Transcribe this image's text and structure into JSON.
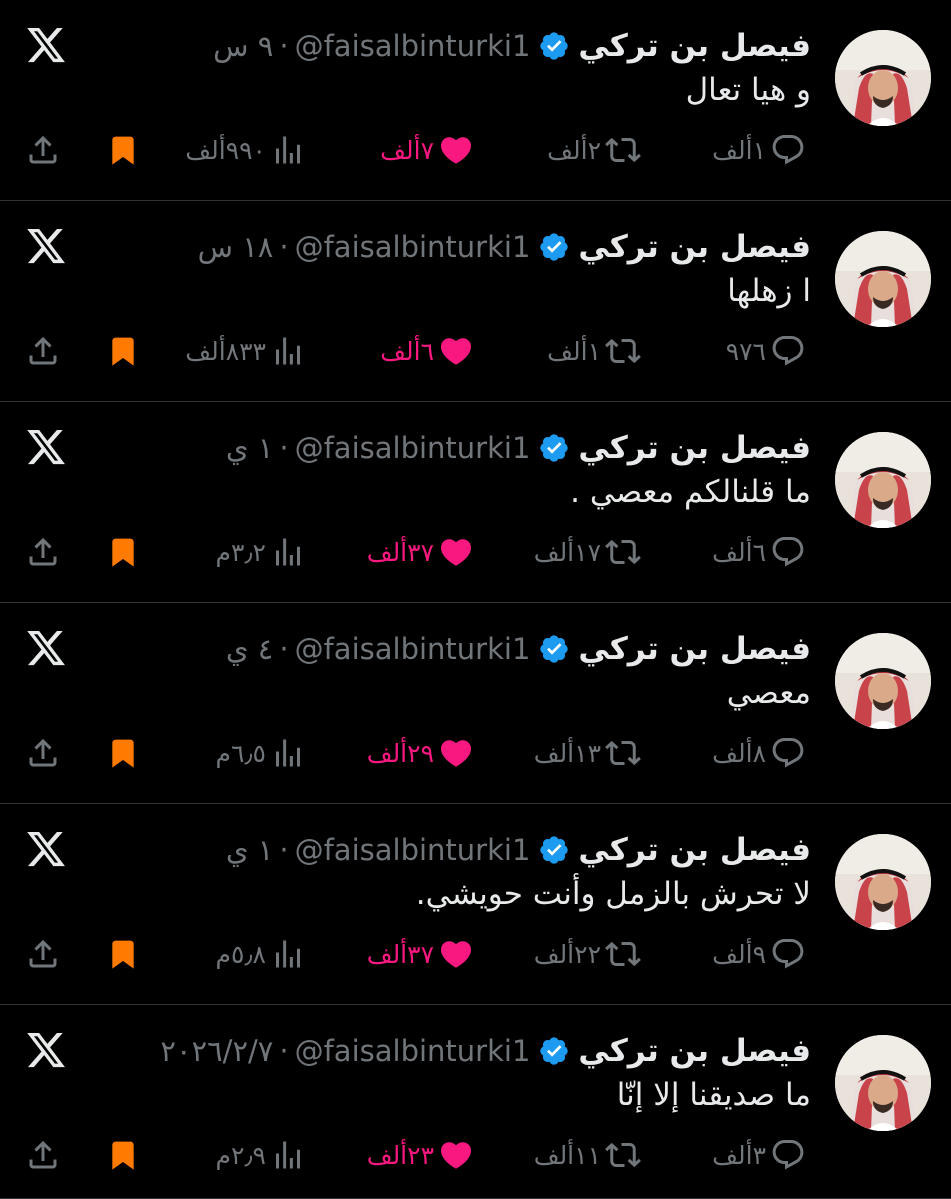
{
  "colors": {
    "background": "#000000",
    "text": "#e7e9ea",
    "muted": "#71767b",
    "like": "#f91880",
    "verified": "#1d9bf0",
    "bookmark": "#ff7a00",
    "divider": "#2f3336"
  },
  "icons": {
    "brand": "x-logo-icon",
    "verified": "verified-badge-icon",
    "reply": "reply-icon",
    "retweet": "retweet-icon",
    "like": "heart-icon",
    "views": "views-icon",
    "bookmark": "bookmark-icon",
    "share": "share-icon"
  },
  "tweets": [
    {
      "name": "فيصل بن تركي",
      "handle": "@faisalbinturki1",
      "separator": "·",
      "time": "٩ س",
      "text": "و هيا تعال",
      "replies": "١ألف",
      "retweets": "٢ألف",
      "likes": "٧ألف",
      "views": "٩٩٠ألف"
    },
    {
      "name": "فيصل بن تركي",
      "handle": "@faisalbinturki1",
      "separator": "·",
      "time": "١٨ س",
      "text": "ا زهلها",
      "replies": "٩٧٦",
      "retweets": "١ألف",
      "likes": "٦ألف",
      "views": "٨٣٣ألف"
    },
    {
      "name": "فيصل بن تركي",
      "handle": "@faisalbinturki1",
      "separator": "·",
      "time": "١ ي",
      "text": "ما قلنالكم معصي .",
      "replies": "٦ألف",
      "retweets": "١٧ألف",
      "likes": "٣٧ألف",
      "views": "٣٫٢م"
    },
    {
      "name": "فيصل بن تركي",
      "handle": "@faisalbinturki1",
      "separator": "·",
      "time": "٤ ي",
      "text": "معصي",
      "replies": "٨ألف",
      "retweets": "١٣ألف",
      "likes": "٢٩ألف",
      "views": "٦٫٥م"
    },
    {
      "name": "فيصل بن تركي",
      "handle": "@faisalbinturki1",
      "separator": "·",
      "time": "١ ي",
      "text": "لا تحرش بالزمل وأنت حويشي.",
      "replies": "٩ألف",
      "retweets": "٢٢ألف",
      "likes": "٣٧ألف",
      "views": "٥٫٨م"
    },
    {
      "name": "فيصل بن تركي",
      "handle": "@faisalbinturki1",
      "separator": "·",
      "time": "٢٠٢٦/٢/٧",
      "text": "ما صديقنا إلا إنّا",
      "replies": "٣ألف",
      "retweets": "١١ألف",
      "likes": "٢٣ألف",
      "views": "٢٫٩م"
    }
  ]
}
